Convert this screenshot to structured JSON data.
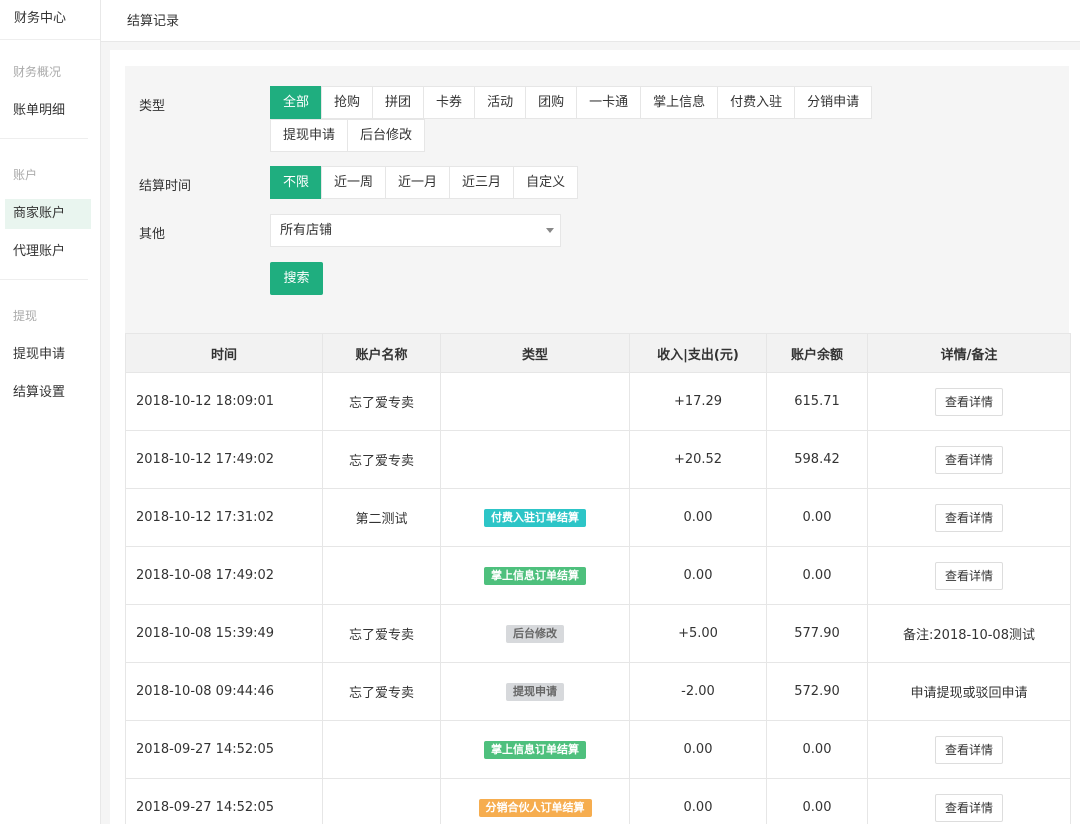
{
  "sidebar": {
    "title": "财务中心",
    "groups": [
      {
        "label": "财务概况",
        "items": [
          {
            "label": "账单明细",
            "active": false
          }
        ]
      },
      {
        "label": "账户",
        "items": [
          {
            "label": "商家账户",
            "active": true
          },
          {
            "label": "代理账户",
            "active": false
          }
        ]
      },
      {
        "label": "提现",
        "items": [
          {
            "label": "提现申请",
            "active": false
          },
          {
            "label": "结算设置",
            "active": false
          }
        ]
      }
    ]
  },
  "header": {
    "title": "结算记录"
  },
  "filters": {
    "type": {
      "label": "类型",
      "options": [
        "全部",
        "抢购",
        "拼团",
        "卡券",
        "活动",
        "团购",
        "一卡通",
        "掌上信息",
        "付费入驻",
        "分销申请",
        "提现申请",
        "后台修改"
      ],
      "selected": 0
    },
    "time": {
      "label": "结算时间",
      "options": [
        "不限",
        "近一周",
        "近一月",
        "近三月",
        "自定义"
      ],
      "selected": 0
    },
    "other": {
      "label": "其他",
      "select_value": "所有店铺"
    },
    "search_label": "搜索"
  },
  "colors": {
    "accent": "#1fae7f",
    "badge_teal": "#2dc5c7",
    "badge_green": "#4ec07d",
    "badge_gray": "#d7d9dc",
    "badge_orange": "#f6ad4f"
  },
  "table": {
    "headers": [
      "时间",
      "账户名称",
      "类型",
      "收入|支出(元)",
      "账户余额",
      "详情/备注"
    ],
    "rows": [
      {
        "time": "2018-10-12 18:09:01",
        "account": "忘了爱专卖",
        "type": "",
        "type_color": "",
        "amount": "+17.29",
        "amount_kind": "pos",
        "balance": "615.71",
        "detail": "查看详情",
        "detail_is_button": true
      },
      {
        "time": "2018-10-12 17:49:02",
        "account": "忘了爱专卖",
        "type": "",
        "type_color": "",
        "amount": "+20.52",
        "amount_kind": "pos",
        "balance": "598.42",
        "detail": "查看详情",
        "detail_is_button": true
      },
      {
        "time": "2018-10-12 17:31:02",
        "account": "第二测试",
        "type": "付费入驻订单结算",
        "type_color": "#2dc5c7",
        "amount": "0.00",
        "amount_kind": "neg",
        "balance": "0.00",
        "detail": "查看详情",
        "detail_is_button": true
      },
      {
        "time": "2018-10-08 17:49:02",
        "account": "",
        "type": "掌上信息订单结算",
        "type_color": "#4ec07d",
        "amount": "0.00",
        "amount_kind": "neg",
        "balance": "0.00",
        "detail": "查看详情",
        "detail_is_button": true
      },
      {
        "time": "2018-10-08 15:39:49",
        "account": "忘了爱专卖",
        "type": "后台修改",
        "type_color": "#d7d9dc",
        "amount": "+5.00",
        "amount_kind": "pos",
        "balance": "577.90",
        "detail": "备注:2018-10-08测试",
        "detail_is_button": false
      },
      {
        "time": "2018-10-08 09:44:46",
        "account": "忘了爱专卖",
        "type": "提现申请",
        "type_color": "#d7d9dc",
        "amount": "-2.00",
        "amount_kind": "neg",
        "balance": "572.90",
        "detail": "申请提现或驳回申请",
        "detail_is_button": false
      },
      {
        "time": "2018-09-27 14:52:05",
        "account": "",
        "type": "掌上信息订单结算",
        "type_color": "#4ec07d",
        "amount": "0.00",
        "amount_kind": "neg",
        "balance": "0.00",
        "detail": "查看详情",
        "detail_is_button": true
      },
      {
        "time": "2018-09-27 14:52:05",
        "account": "",
        "type": "分销合伙人订单结算",
        "type_color": "#f6ad4f",
        "amount": "0.00",
        "amount_kind": "neg",
        "balance": "0.00",
        "detail": "查看详情",
        "detail_is_button": true
      }
    ]
  }
}
